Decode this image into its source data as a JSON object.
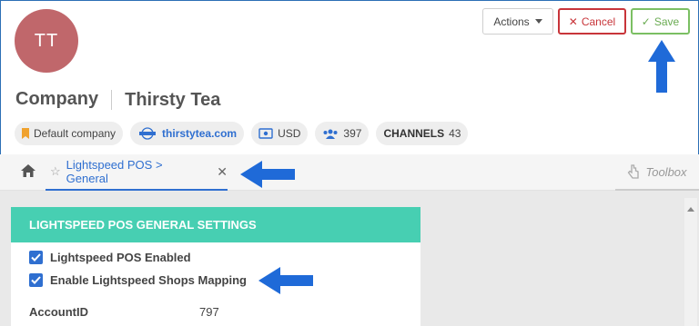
{
  "header": {
    "avatar_initials": "TT",
    "title_label": "Company",
    "company_name": "Thirsty Tea"
  },
  "buttons": {
    "actions_label": "Actions",
    "cancel_label": "Cancel",
    "save_label": "Save"
  },
  "chips": {
    "default_company": "Default company",
    "website": "thirstytea.com",
    "currency": "USD",
    "user_count": "397",
    "channels_label": "CHANNELS",
    "channels_count": "43"
  },
  "tabs": {
    "active_tab_label": "Lightspeed POS > General",
    "toolbox_label": "Toolbox"
  },
  "panel": {
    "title": "LIGHTSPEED POS GENERAL SETTINGS",
    "checkboxes": [
      {
        "label": "Lightspeed POS Enabled",
        "checked": true
      },
      {
        "label": "Enable Lightspeed Shops Mapping",
        "checked": true
      }
    ],
    "fields": [
      {
        "label": "AccountID",
        "value": "797"
      }
    ]
  },
  "colors": {
    "accent_blue": "#2f6fd0",
    "panel_header": "#47cfb2",
    "cancel_red": "#c8353a",
    "save_green": "#7bbf63",
    "avatar_bg": "#c0676b"
  }
}
